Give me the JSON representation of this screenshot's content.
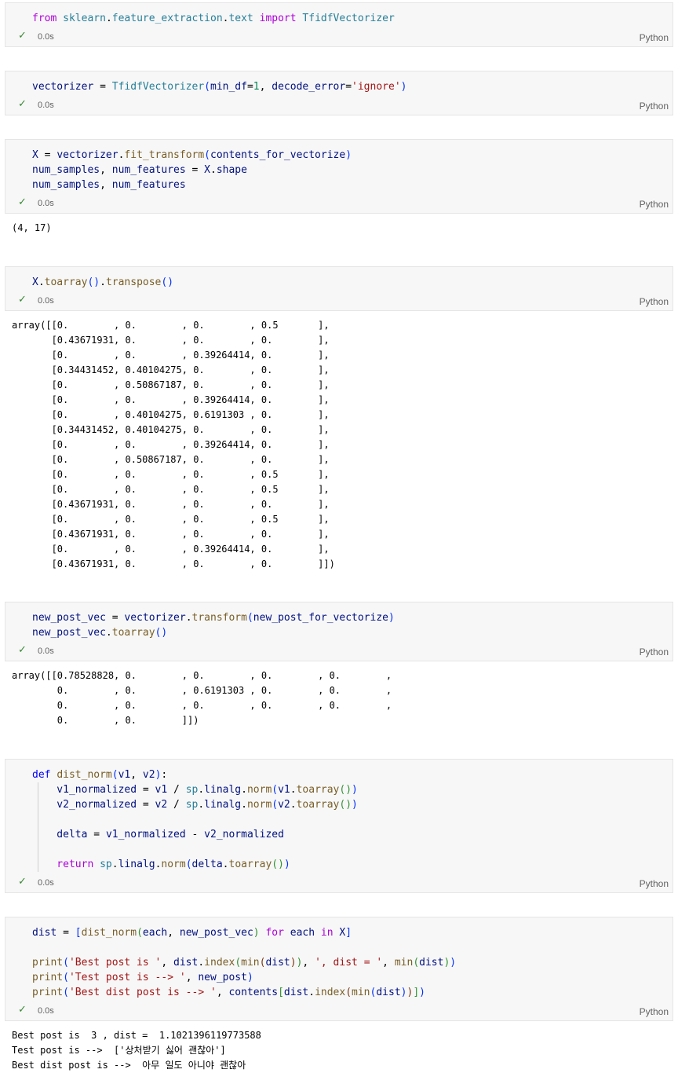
{
  "cells": [
    {
      "id": "c1",
      "status": "0.0s",
      "language": "Python",
      "lines": [
        [
          {
            "t": "from",
            "c": "kw"
          },
          {
            "t": " sklearn",
            "c": "mod"
          },
          {
            "t": ".",
            "c": ""
          },
          {
            "t": "feature_extraction",
            "c": "mod"
          },
          {
            "t": ".",
            "c": ""
          },
          {
            "t": "text",
            "c": "mod"
          },
          {
            "t": " import ",
            "c": "kw"
          },
          {
            "t": "TfidfVectorizer",
            "c": "cls"
          }
        ]
      ]
    },
    {
      "id": "c2",
      "status": "0.0s",
      "language": "Python",
      "lines": [
        [
          {
            "t": "vectorizer",
            "c": "var"
          },
          {
            "t": " = ",
            "c": ""
          },
          {
            "t": "TfidfVectorizer",
            "c": "cls"
          },
          {
            "t": "(",
            "c": "p1"
          },
          {
            "t": "min_df",
            "c": "var"
          },
          {
            "t": "=",
            "c": ""
          },
          {
            "t": "1",
            "c": "num"
          },
          {
            "t": ", ",
            "c": ""
          },
          {
            "t": "decode_error",
            "c": "var"
          },
          {
            "t": "=",
            "c": ""
          },
          {
            "t": "'ignore'",
            "c": "str"
          },
          {
            "t": ")",
            "c": "p1"
          }
        ]
      ]
    },
    {
      "id": "c3",
      "status": "0.0s",
      "language": "Python",
      "lines": [
        [
          {
            "t": "X",
            "c": "var"
          },
          {
            "t": " = ",
            "c": ""
          },
          {
            "t": "vectorizer",
            "c": "var"
          },
          {
            "t": ".",
            "c": ""
          },
          {
            "t": "fit_transform",
            "c": "fn"
          },
          {
            "t": "(",
            "c": "p1"
          },
          {
            "t": "contents_for_vectorize",
            "c": "var"
          },
          {
            "t": ")",
            "c": "p1"
          }
        ],
        [
          {
            "t": "num_samples",
            "c": "var"
          },
          {
            "t": ", ",
            "c": ""
          },
          {
            "t": "num_features",
            "c": "var"
          },
          {
            "t": " = ",
            "c": ""
          },
          {
            "t": "X",
            "c": "var"
          },
          {
            "t": ".",
            "c": ""
          },
          {
            "t": "shape",
            "c": "var"
          }
        ],
        [
          {
            "t": "num_samples",
            "c": "var"
          },
          {
            "t": ", ",
            "c": ""
          },
          {
            "t": "num_features",
            "c": "var"
          }
        ]
      ],
      "output": [
        "(4, 17)"
      ]
    },
    {
      "id": "c4",
      "status": "0.0s",
      "language": "Python",
      "lines": [
        [
          {
            "t": "X",
            "c": "var"
          },
          {
            "t": ".",
            "c": ""
          },
          {
            "t": "toarray",
            "c": "fn"
          },
          {
            "t": "()",
            "c": "p1"
          },
          {
            "t": ".",
            "c": ""
          },
          {
            "t": "transpose",
            "c": "fn"
          },
          {
            "t": "()",
            "c": "p1"
          }
        ]
      ],
      "output": [
        "array([[0.        , 0.        , 0.        , 0.5       ],",
        "       [0.43671931, 0.        , 0.        , 0.        ],",
        "       [0.        , 0.        , 0.39264414, 0.        ],",
        "       [0.34431452, 0.40104275, 0.        , 0.        ],",
        "       [0.        , 0.50867187, 0.        , 0.        ],",
        "       [0.        , 0.        , 0.39264414, 0.        ],",
        "       [0.        , 0.40104275, 0.6191303 , 0.        ],",
        "       [0.34431452, 0.40104275, 0.        , 0.        ],",
        "       [0.        , 0.        , 0.39264414, 0.        ],",
        "       [0.        , 0.50867187, 0.        , 0.        ],",
        "       [0.        , 0.        , 0.        , 0.5       ],",
        "       [0.        , 0.        , 0.        , 0.5       ],",
        "       [0.43671931, 0.        , 0.        , 0.        ],",
        "       [0.        , 0.        , 0.        , 0.5       ],",
        "       [0.43671931, 0.        , 0.        , 0.        ],",
        "       [0.        , 0.        , 0.39264414, 0.        ],",
        "       [0.43671931, 0.        , 0.        , 0.        ]])"
      ]
    },
    {
      "id": "c5",
      "status": "0.0s",
      "language": "Python",
      "lines": [
        [
          {
            "t": "new_post_vec",
            "c": "var"
          },
          {
            "t": " = ",
            "c": ""
          },
          {
            "t": "vectorizer",
            "c": "var"
          },
          {
            "t": ".",
            "c": ""
          },
          {
            "t": "transform",
            "c": "fn"
          },
          {
            "t": "(",
            "c": "p1"
          },
          {
            "t": "new_post_for_vectorize",
            "c": "var"
          },
          {
            "t": ")",
            "c": "p1"
          }
        ],
        [
          {
            "t": "new_post_vec",
            "c": "var"
          },
          {
            "t": ".",
            "c": ""
          },
          {
            "t": "toarray",
            "c": "fn"
          },
          {
            "t": "()",
            "c": "p1"
          }
        ]
      ],
      "output": [
        "array([[0.78528828, 0.        , 0.        , 0.        , 0.        ,",
        "        0.        , 0.        , 0.6191303 , 0.        , 0.        ,",
        "        0.        , 0.        , 0.        , 0.        , 0.        ,",
        "        0.        , 0.        ]])"
      ]
    },
    {
      "id": "c6",
      "status": "0.0s",
      "language": "Python",
      "lines": [
        [
          {
            "t": "def",
            "c": "kw2"
          },
          {
            "t": " ",
            "c": ""
          },
          {
            "t": "dist_norm",
            "c": "fn"
          },
          {
            "t": "(",
            "c": "p1"
          },
          {
            "t": "v1",
            "c": "var"
          },
          {
            "t": ", ",
            "c": ""
          },
          {
            "t": "v2",
            "c": "var"
          },
          {
            "t": ")",
            "c": "p1"
          },
          {
            "t": ":",
            "c": ""
          }
        ],
        [
          {
            "t": "    v1_normalized",
            "c": "var"
          },
          {
            "t": " = ",
            "c": ""
          },
          {
            "t": "v1",
            "c": "var"
          },
          {
            "t": " / ",
            "c": ""
          },
          {
            "t": "sp",
            "c": "mod"
          },
          {
            "t": ".",
            "c": ""
          },
          {
            "t": "linalg",
            "c": "var"
          },
          {
            "t": ".",
            "c": ""
          },
          {
            "t": "norm",
            "c": "fn"
          },
          {
            "t": "(",
            "c": "p1"
          },
          {
            "t": "v1",
            "c": "var"
          },
          {
            "t": ".",
            "c": ""
          },
          {
            "t": "toarray",
            "c": "fn"
          },
          {
            "t": "()",
            "c": "p2"
          },
          {
            "t": ")",
            "c": "p1"
          }
        ],
        [
          {
            "t": "    v2_normalized",
            "c": "var"
          },
          {
            "t": " = ",
            "c": ""
          },
          {
            "t": "v2",
            "c": "var"
          },
          {
            "t": " / ",
            "c": ""
          },
          {
            "t": "sp",
            "c": "mod"
          },
          {
            "t": ".",
            "c": ""
          },
          {
            "t": "linalg",
            "c": "var"
          },
          {
            "t": ".",
            "c": ""
          },
          {
            "t": "norm",
            "c": "fn"
          },
          {
            "t": "(",
            "c": "p1"
          },
          {
            "t": "v2",
            "c": "var"
          },
          {
            "t": ".",
            "c": ""
          },
          {
            "t": "toarray",
            "c": "fn"
          },
          {
            "t": "()",
            "c": "p2"
          },
          {
            "t": ")",
            "c": "p1"
          }
        ],
        [],
        [
          {
            "t": "    delta",
            "c": "var"
          },
          {
            "t": " = ",
            "c": ""
          },
          {
            "t": "v1_normalized",
            "c": "var"
          },
          {
            "t": " - ",
            "c": ""
          },
          {
            "t": "v2_normalized",
            "c": "var"
          }
        ],
        [],
        [
          {
            "t": "    return",
            "c": "kw"
          },
          {
            "t": " ",
            "c": ""
          },
          {
            "t": "sp",
            "c": "mod"
          },
          {
            "t": ".",
            "c": ""
          },
          {
            "t": "linalg",
            "c": "var"
          },
          {
            "t": ".",
            "c": ""
          },
          {
            "t": "norm",
            "c": "fn"
          },
          {
            "t": "(",
            "c": "p1"
          },
          {
            "t": "delta",
            "c": "var"
          },
          {
            "t": ".",
            "c": ""
          },
          {
            "t": "toarray",
            "c": "fn"
          },
          {
            "t": "()",
            "c": "p2"
          },
          {
            "t": ")",
            "c": "p1"
          }
        ]
      ]
    },
    {
      "id": "c7",
      "status": "0.0s",
      "language": "Python",
      "lines": [
        [
          {
            "t": "dist",
            "c": "var"
          },
          {
            "t": " = ",
            "c": ""
          },
          {
            "t": "[",
            "c": "p1"
          },
          {
            "t": "dist_norm",
            "c": "fn"
          },
          {
            "t": "(",
            "c": "p2"
          },
          {
            "t": "each",
            "c": "var"
          },
          {
            "t": ", ",
            "c": ""
          },
          {
            "t": "new_post_vec",
            "c": "var"
          },
          {
            "t": ")",
            "c": "p2"
          },
          {
            "t": " for ",
            "c": "kw"
          },
          {
            "t": "each",
            "c": "var"
          },
          {
            "t": " in ",
            "c": "kw"
          },
          {
            "t": "X",
            "c": "var"
          },
          {
            "t": "]",
            "c": "p1"
          }
        ],
        [],
        [
          {
            "t": "print",
            "c": "fn"
          },
          {
            "t": "(",
            "c": "p1"
          },
          {
            "t": "'Best post is '",
            "c": "str"
          },
          {
            "t": ", ",
            "c": ""
          },
          {
            "t": "dist",
            "c": "var"
          },
          {
            "t": ".",
            "c": ""
          },
          {
            "t": "index",
            "c": "fn"
          },
          {
            "t": "(",
            "c": "p2"
          },
          {
            "t": "min",
            "c": "fn"
          },
          {
            "t": "(",
            "c": "p3"
          },
          {
            "t": "dist",
            "c": "var"
          },
          {
            "t": ")",
            "c": "p3"
          },
          {
            "t": ")",
            "c": "p2"
          },
          {
            "t": ", ",
            "c": ""
          },
          {
            "t": "', dist = '",
            "c": "str"
          },
          {
            "t": ", ",
            "c": ""
          },
          {
            "t": "min",
            "c": "fn"
          },
          {
            "t": "(",
            "c": "p2"
          },
          {
            "t": "dist",
            "c": "var"
          },
          {
            "t": ")",
            "c": "p2"
          },
          {
            "t": ")",
            "c": "p1"
          }
        ],
        [
          {
            "t": "print",
            "c": "fn"
          },
          {
            "t": "(",
            "c": "p1"
          },
          {
            "t": "'Test post is --> '",
            "c": "str"
          },
          {
            "t": ", ",
            "c": ""
          },
          {
            "t": "new_post",
            "c": "var"
          },
          {
            "t": ")",
            "c": "p1"
          }
        ],
        [
          {
            "t": "print",
            "c": "fn"
          },
          {
            "t": "(",
            "c": "p1"
          },
          {
            "t": "'Best dist post is --> '",
            "c": "str"
          },
          {
            "t": ", ",
            "c": ""
          },
          {
            "t": "contents",
            "c": "var"
          },
          {
            "t": "[",
            "c": "p2"
          },
          {
            "t": "dist",
            "c": "var"
          },
          {
            "t": ".",
            "c": ""
          },
          {
            "t": "index",
            "c": "fn"
          },
          {
            "t": "(",
            "c": "p3"
          },
          {
            "t": "min",
            "c": "fn"
          },
          {
            "t": "(",
            "c": "p1"
          },
          {
            "t": "dist",
            "c": "var"
          },
          {
            "t": ")",
            "c": "p1"
          },
          {
            "t": ")",
            "c": "p3"
          },
          {
            "t": "]",
            "c": "p2"
          },
          {
            "t": ")",
            "c": "p1"
          }
        ]
      ],
      "output": [
        "Best post is  3 , dist =  1.1021396119773588",
        "Test post is -->  ['상처받기 싫어 괜찮아']",
        "Best dist post is -->  아무 일도 아니야 괜찮아"
      ]
    }
  ],
  "icons": {
    "status_ok": "check-icon"
  },
  "colors": {
    "success": "#388a34",
    "cell_bg": "#f7f7f7"
  }
}
